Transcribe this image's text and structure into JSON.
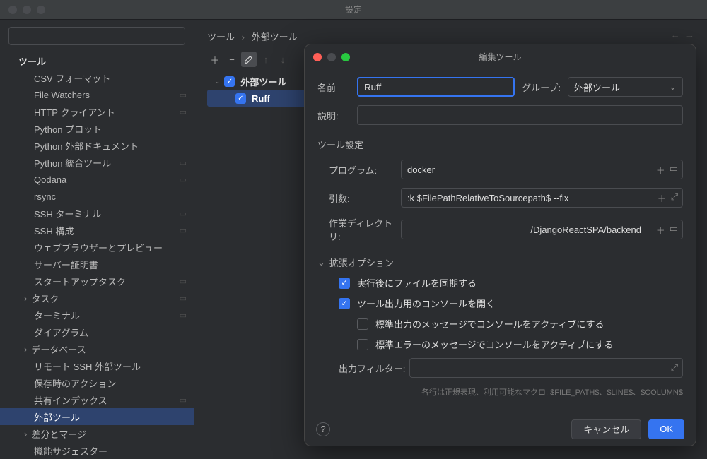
{
  "window": {
    "title": "設定"
  },
  "search": {
    "placeholder": ""
  },
  "breadcrumb": {
    "root": "ツール",
    "leaf": "外部ツール"
  },
  "sidebar": {
    "header": "ツール",
    "items": [
      {
        "label": "CSV フォーマット"
      },
      {
        "label": "File Watchers",
        "sep": true
      },
      {
        "label": "HTTP クライアント",
        "sep": true
      },
      {
        "label": "Python プロット"
      },
      {
        "label": "Python 外部ドキュメント"
      },
      {
        "label": "Python 統合ツール",
        "sep": true
      },
      {
        "label": "Qodana",
        "sep": true
      },
      {
        "label": "rsync"
      },
      {
        "label": "SSH ターミナル",
        "sep": true
      },
      {
        "label": "SSH 構成",
        "sep": true
      },
      {
        "label": "ウェブブラウザーとプレビュー"
      },
      {
        "label": "サーバー証明書"
      },
      {
        "label": "スタートアップタスク",
        "sep": true
      },
      {
        "label": "タスク",
        "sep": true,
        "exp": true
      },
      {
        "label": "ターミナル",
        "sep": true
      },
      {
        "label": "ダイアグラム"
      },
      {
        "label": "データベース",
        "exp": true
      },
      {
        "label": "リモート SSH 外部ツール"
      },
      {
        "label": "保存時のアクション"
      },
      {
        "label": "共有インデックス",
        "sep": true
      },
      {
        "label": "外部ツール",
        "selected": true
      },
      {
        "label": "差分とマージ",
        "exp": true
      },
      {
        "label": "機能サジェスター"
      }
    ]
  },
  "tools_list": {
    "group": "外部ツール",
    "item": "Ruff"
  },
  "modal": {
    "title": "編集ツール",
    "name_label": "名前",
    "name_value": "Ruff",
    "group_label": "グループ:",
    "group_value": "外部ツール",
    "desc_label": "説明:",
    "desc_value": "",
    "section_tool": "ツール設定",
    "program_label": "プログラム:",
    "program_value": "docker",
    "args_label": "引数:",
    "args_value": ":k $FilePathRelativeToSourcepath$ --fix",
    "workdir_label": "作業ディレクトリ:",
    "workdir_value": "/DjangoReactSPA/backend",
    "adv_label": "拡張オプション",
    "opt_sync": "実行後にファイルを同期する",
    "opt_console": "ツール出力用のコンソールを開く",
    "opt_stdout": "標準出力のメッセージでコンソールをアクティブにする",
    "opt_stderr": "標準エラーのメッセージでコンソールをアクティブにする",
    "filter_label": "出力フィルター:",
    "filter_hint": "各行は正規表現、利用可能なマクロ: $FILE_PATH$、$LINE$、$COLUMN$",
    "cancel": "キャンセル",
    "ok": "OK"
  }
}
